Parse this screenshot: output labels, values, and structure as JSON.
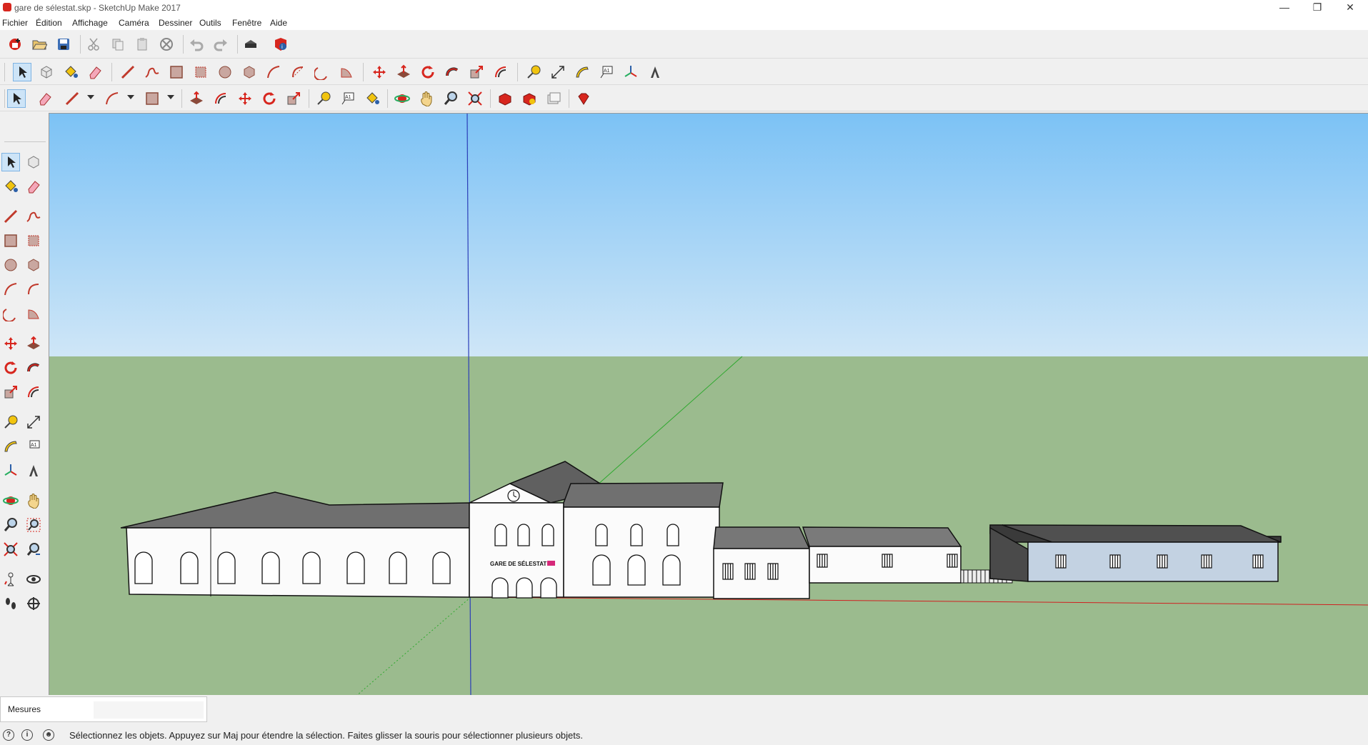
{
  "window": {
    "title": "gare de sélestat.skp - SketchUp Make 2017",
    "controls": [
      "minimize-icon",
      "restore-icon",
      "close-icon"
    ]
  },
  "menu": [
    "Fichier",
    "Édition",
    "Affichage",
    "Caméra",
    "Dessiner",
    "Outils",
    "Fenêtre",
    "Aide"
  ],
  "toolbars": {
    "standard": [
      "new-icon",
      "open-icon",
      "save-icon",
      "cut-icon",
      "copy-icon",
      "paste-icon",
      "erase-icon",
      "undo-icon",
      "redo-icon",
      "print-icon",
      "model-info-icon"
    ],
    "large_tools": [
      "select-icon",
      "component-icon",
      "paint-bucket-icon",
      "eraser-icon",
      "line-icon",
      "freehand-icon",
      "rectangle-icon",
      "rotated-rectangle-icon",
      "circle-icon",
      "polygon-icon",
      "arc-icon",
      "two-point-arc-icon",
      "three-point-arc-icon",
      "pie-icon",
      "move-icon",
      "push-pull-icon",
      "rotate-icon",
      "follow-me-icon",
      "scale-icon",
      "offset-icon",
      "tape-measure-icon",
      "dimension-icon",
      "protractor-icon",
      "text-icon",
      "axes-icon",
      "3d-text-icon"
    ],
    "getting_started": [
      "select-icon",
      "eraser-icon",
      "line-icon",
      "arc-icon",
      "rectangle-icon",
      "push-pull-icon",
      "offset-icon",
      "move-icon",
      "rotate-icon",
      "scale-icon",
      "tape-measure-icon",
      "text-icon",
      "paint-bucket-icon",
      "orbit-icon",
      "pan-icon",
      "zoom-icon",
      "zoom-extents-icon",
      "3d-warehouse-icon",
      "extension-warehouse-icon",
      "layout-icon",
      "ruby-icon"
    ]
  },
  "left_tools": [
    "select-icon",
    "component-icon",
    "paint-bucket-icon",
    "eraser-icon",
    "line-icon",
    "freehand-icon",
    "rectangle-icon",
    "rotated-rectangle-icon",
    "circle-icon",
    "polygon-icon",
    "arc-icon",
    "two-point-arc-icon",
    "three-point-arc-icon",
    "pie-icon",
    "move-icon",
    "push-pull-icon",
    "rotate-icon",
    "follow-me-icon",
    "scale-icon",
    "offset-icon",
    "tape-measure-icon",
    "dimension-icon",
    "protractor-icon",
    "text-icon",
    "axes-icon",
    "3d-text-icon",
    "orbit-icon",
    "pan-icon",
    "zoom-icon",
    "zoom-window-icon",
    "zoom-extents-icon",
    "previous-view-icon",
    "position-camera-icon",
    "look-around-icon",
    "walk-icon",
    "section-plane-icon"
  ],
  "scene": {
    "station_sign": "GARE DE SÉLESTAT",
    "sky_top": "#7cc2f5",
    "sky_bottom": "#cfe6f7",
    "ground": "#9bbb8e"
  },
  "measures": {
    "label": "Mesures",
    "value": ""
  },
  "status": {
    "icons": [
      "geo-location-icon",
      "info-icon",
      "user-icon"
    ],
    "message": "Sélectionnez les objets. Appuyez sur Maj pour étendre la sélection. Faites glisser la souris pour sélectionner plusieurs objets."
  },
  "colors": {
    "accent_red": "#d7261e",
    "active_bg": "#cde4f7"
  }
}
